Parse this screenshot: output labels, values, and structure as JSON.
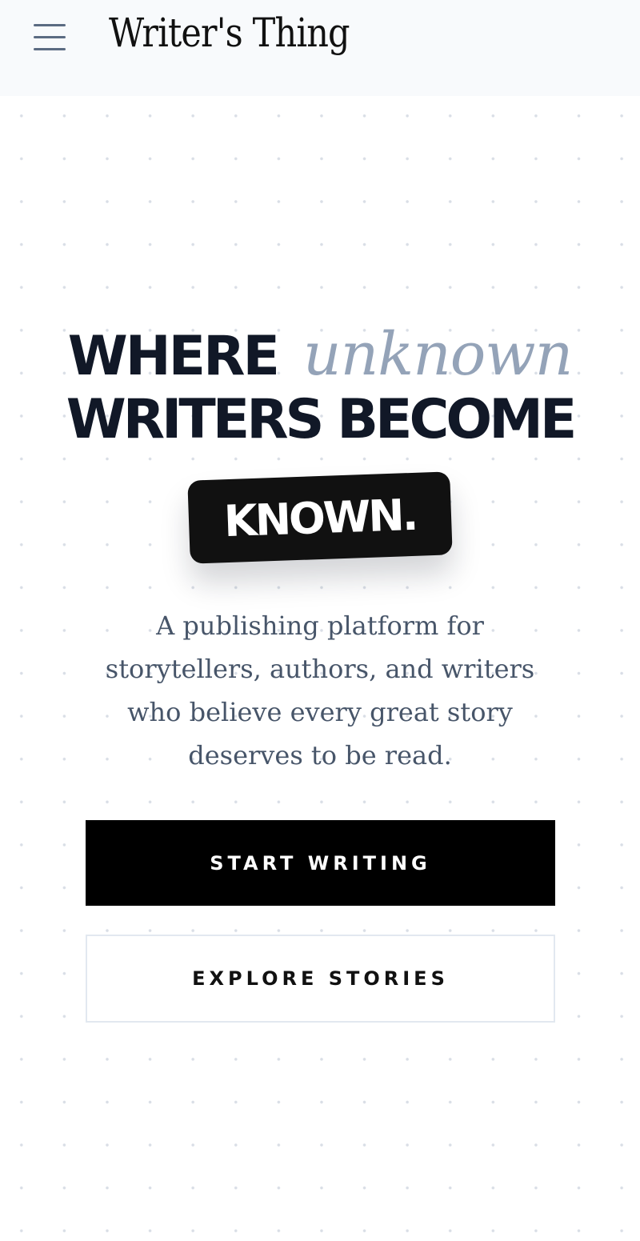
{
  "header": {
    "menu_icon": "hamburger-menu-icon",
    "logo": "Writer's Thing"
  },
  "hero": {
    "headline_where": "WHERE",
    "headline_unknown": "unknown",
    "headline_line2": "WRITERS BECOME",
    "headline_known": "KNOWN.",
    "subtitle": "A publishing platform for storytellers, authors, and writers who believe every great story deserves to be read."
  },
  "actions": {
    "start_writing": "START WRITING",
    "explore_stories": "EXPLORE STORIES"
  },
  "colors": {
    "ink": "#111827",
    "muted_accent": "#94a3b8",
    "subtitle_text": "#475569",
    "primary_button_bg": "#000000",
    "secondary_button_border": "#e2e8f0"
  }
}
